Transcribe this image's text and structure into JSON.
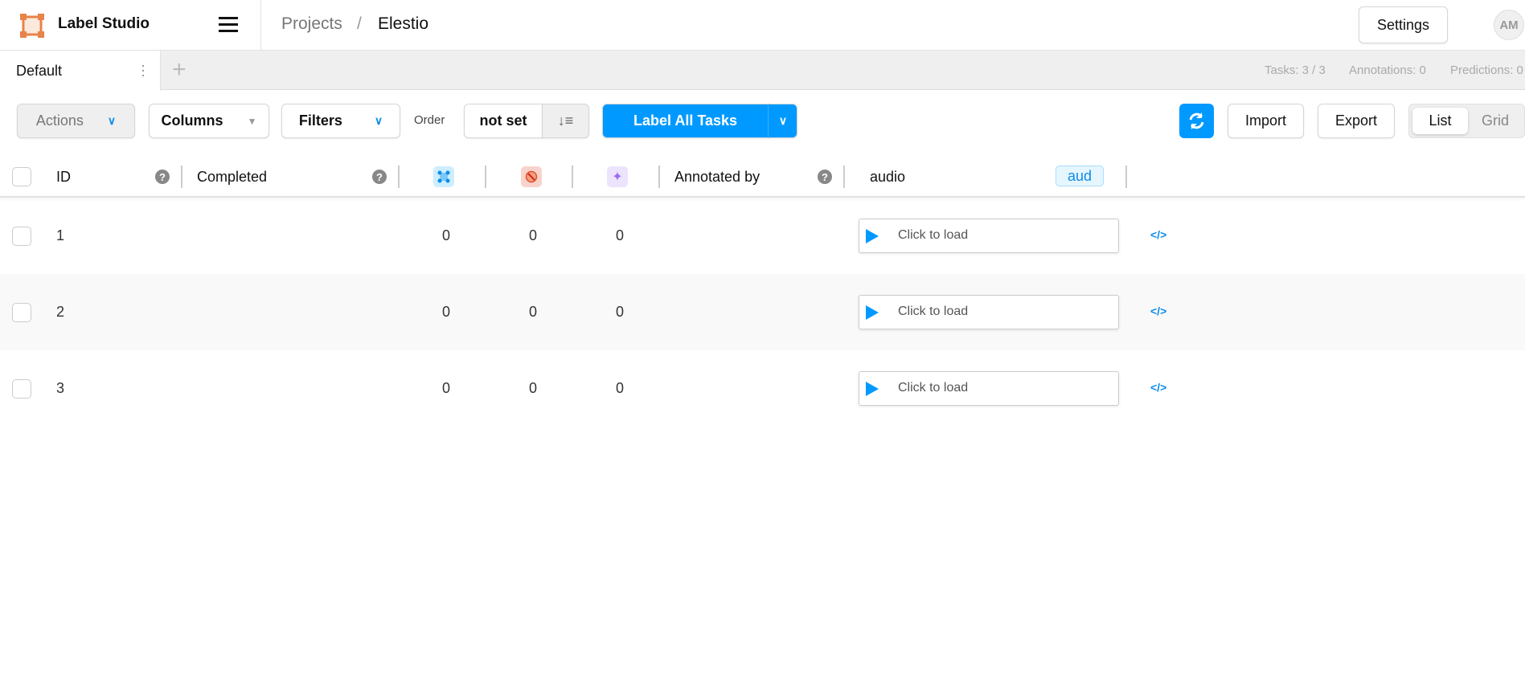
{
  "header": {
    "brand": "Label Studio",
    "breadcrumb": [
      "Projects",
      "/",
      "Elestio"
    ],
    "settings_label": "Settings",
    "avatar_initials": "AM"
  },
  "tabs": {
    "active": "Default",
    "stats": {
      "tasks": "Tasks: 3 / 3",
      "annotations": "Annotations: 0",
      "predictions": "Predictions: 0"
    }
  },
  "toolbar": {
    "actions": "Actions",
    "columns": "Columns",
    "filters": "Filters",
    "order_label": "Order",
    "order_value": "not set",
    "label_all": "Label All Tasks",
    "import": "Import",
    "export": "Export",
    "view_list": "List",
    "view_grid": "Grid"
  },
  "columns": {
    "id": "ID",
    "completed": "Completed",
    "annotated_by": "Annotated by",
    "audio": "audio",
    "audio_badge": "aud"
  },
  "rows": [
    {
      "id": "1",
      "total_annotations": "0",
      "cancelled": "0",
      "predictions": "0",
      "audio_label": "Click to load"
    },
    {
      "id": "2",
      "total_annotations": "0",
      "cancelled": "0",
      "predictions": "0",
      "audio_label": "Click to load"
    },
    {
      "id": "3",
      "total_annotations": "0",
      "cancelled": "0",
      "predictions": "0",
      "audio_label": "Click to load"
    }
  ],
  "colors": {
    "accent": "#0099ff",
    "logo": "#e8834a"
  }
}
